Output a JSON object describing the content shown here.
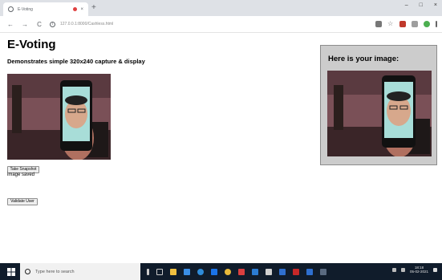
{
  "browser": {
    "tab_title": "E-Voting",
    "tab_close": "×",
    "new_tab": "+",
    "url": "127.0.0.1:8000/Cashless.html",
    "window_controls": {
      "minimize": "–",
      "maximize": "□",
      "close": "×"
    },
    "nav": {
      "back": "←",
      "forward": "→",
      "reload": "C"
    },
    "info_glyph": "i"
  },
  "page": {
    "title": "E-Voting",
    "subtitle": "Demonstrates simple 320x240 capture & display",
    "snapshot_button": "Take Snapshot",
    "status": "image saved",
    "validate_button": "Validate User",
    "result_heading": "Here is your image:"
  },
  "taskbar": {
    "search_placeholder": "Type here to search",
    "time": "18:18",
    "date": "05-02-2021"
  },
  "colors": {
    "panel_bg": "#cccccc",
    "taskbar_bg": "#101c2b",
    "tab_bar_bg": "#dee1e6"
  }
}
